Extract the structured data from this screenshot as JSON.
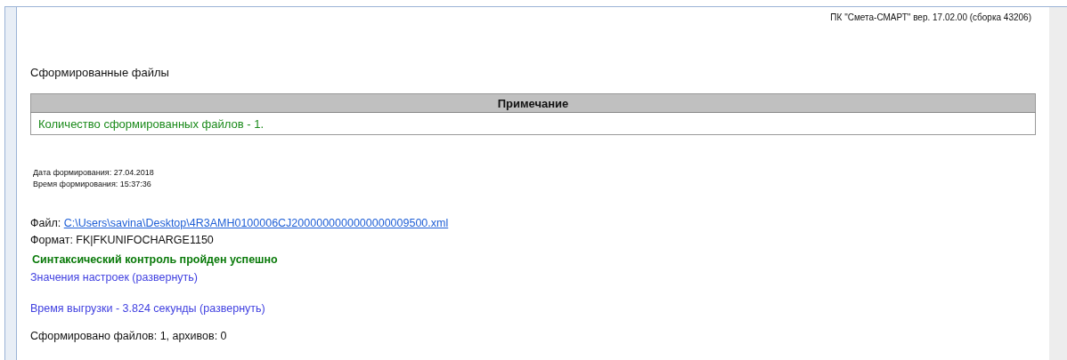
{
  "version_label": "ПК \"Смета-СМАРТ\" вер. 17.02.00 (сборка 43206)",
  "heading": "Сформированные файлы",
  "notes_table": {
    "columns": [
      "Примечание"
    ],
    "rows": [
      [
        "Количество сформированных файлов - 1."
      ]
    ]
  },
  "dates": [
    "Дата формирования: 27.04.2018",
    "Время формирования: 15:37:36"
  ],
  "file": {
    "label": "Файл:",
    "path": "C:\\Users\\savina\\Desktop\\4R3AMH0100006CJ2000000000000000009500.xml"
  },
  "format": "Формат: FK|FKUNIFOCHARGE1150",
  "status": "Синтаксический контроль пройден успешно",
  "settings_link": "Значения настроек (развернуть)",
  "timing_link": "Время выгрузки - 3.824 секунды (развернуть)",
  "summary": "Сформировано файлов: 1, архивов: 0"
}
